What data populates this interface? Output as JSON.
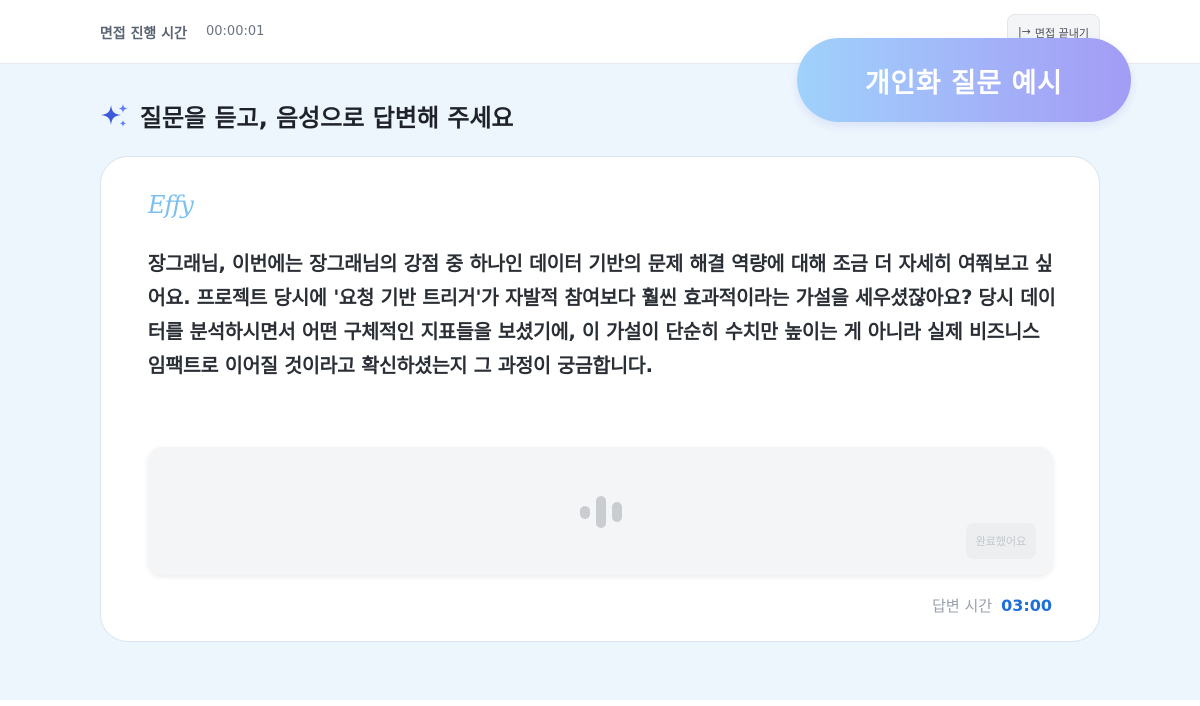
{
  "header": {
    "timer_label": "면접 진행 시간",
    "timer_value": "00:00:01",
    "end_button_icon": "|→",
    "end_button_label": "면접 끝내기"
  },
  "overlay_pill": {
    "label": "개인화 질문 예시"
  },
  "main": {
    "heading": "질문을 듣고, 음성으로 답변해 주세요",
    "heading_icon": "sparkle-icon",
    "card": {
      "brand": "Effy",
      "question": "장그래님, 이번에는 장그래님의 강점 중 하나인 데이터 기반의 문제 해결 역량에 대해 조금 더 자세히 여쭤보고 싶어요. 프로젝트 당시에 '요청 기반 트리거'가 자발적 참여보다 훨씬 효과적이라는 가설을 세우셨잖아요? 당시 데이터를 분석하시면서 어떤 구체적인 지표들을 보셨기에, 이 가설이 단순히 수치만 높이는 게 아니라 실제 비즈니스 임팩트로 이어질 것이라고 확신하셨는지 그 과정이 궁금합니다.",
      "answer_box": {
        "wave_icon": "audio-wave-icon",
        "done_button_label": "완료했어요"
      },
      "answer_time_label": "답변 시간",
      "answer_time_value": "03:00"
    }
  },
  "colors": {
    "background": "#eef6fd",
    "accent_blue": "#1f6fd9",
    "brand_blue": "#7cc0f2",
    "pill_gradient_start": "#9fd2fb",
    "pill_gradient_end": "#a39cf5",
    "sparkle_blue": "#3b5bdb"
  }
}
